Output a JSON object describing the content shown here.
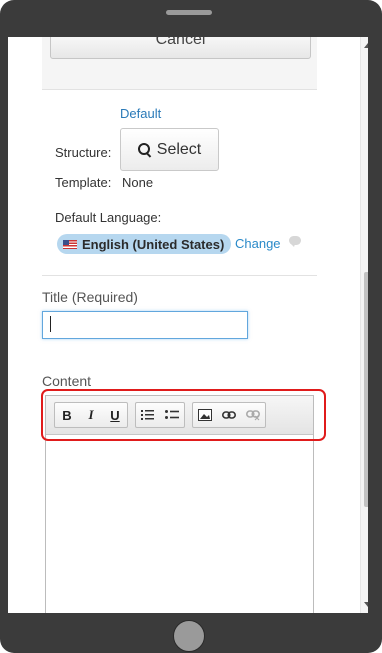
{
  "article_form": {
    "cancel_label": "Cancel",
    "structure": {
      "default_label": "Default",
      "label": "Structure:",
      "select_label": "Select"
    },
    "template": {
      "label": "Template:",
      "value": "None"
    },
    "language": {
      "label": "Default Language:",
      "value": "English (United States)",
      "change_label": "Change",
      "flag_icon": "us-flag-icon"
    },
    "title": {
      "label": "Title (Required)",
      "value": ""
    },
    "content": {
      "label": "Content",
      "toolbar": [
        {
          "name": "bold",
          "glyph": "B"
        },
        {
          "name": "italic",
          "glyph": "I"
        },
        {
          "name": "underline",
          "glyph": "U"
        },
        {
          "name": "ordered-list",
          "icon": "ordered-list-icon"
        },
        {
          "name": "unordered-list",
          "icon": "unordered-list-icon"
        },
        {
          "name": "image",
          "icon": "image-icon"
        },
        {
          "name": "link",
          "icon": "link-icon"
        },
        {
          "name": "unlink",
          "icon": "unlink-icon"
        }
      ]
    }
  },
  "colors": {
    "link": "#2a8ac9",
    "highlight": "#e01b1b",
    "language_badge": "#b6d7ef"
  }
}
